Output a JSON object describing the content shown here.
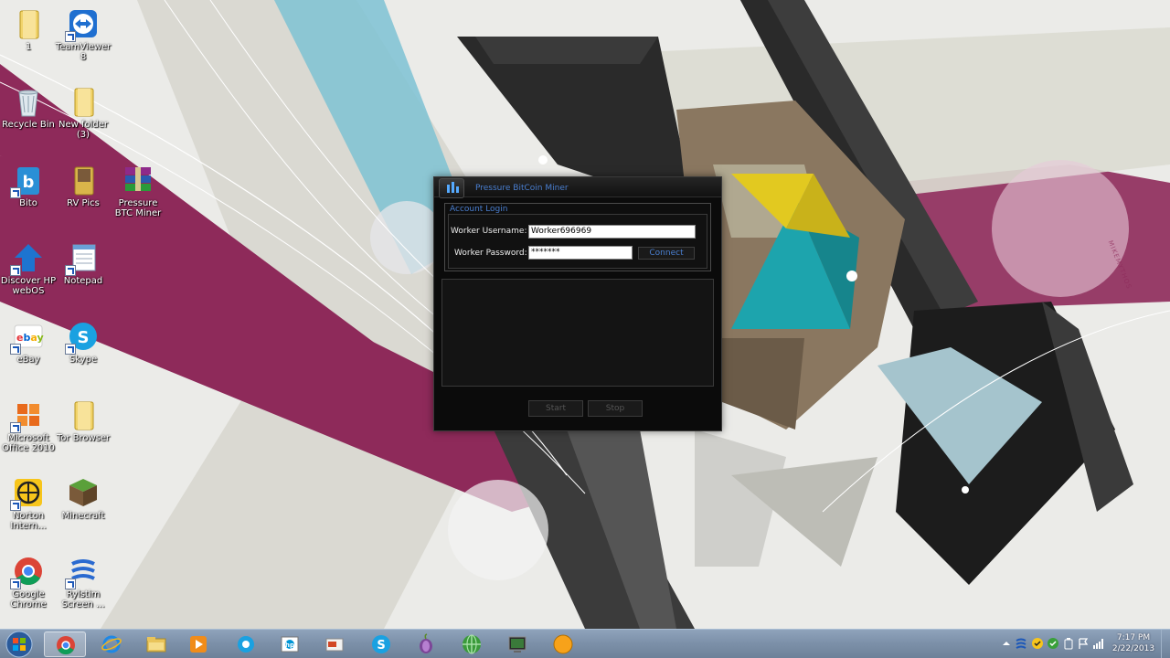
{
  "desktop": {
    "icons": [
      {
        "label": "1",
        "icon": "folder-icon"
      },
      {
        "label": "TeamViewer 8",
        "icon": "teamviewer-icon"
      },
      {
        "label": "Recycle Bin",
        "icon": "recycle-bin-icon"
      },
      {
        "label": "New folder (3)",
        "icon": "folder-icon"
      },
      {
        "label": "Bito",
        "icon": "bito-icon"
      },
      {
        "label": "RV Pics",
        "icon": "folder-icon"
      },
      {
        "label": "Pressure BTC Miner",
        "icon": "winrar-icon"
      },
      {
        "label": "Discover HP webOS",
        "icon": "hp-webos-icon"
      },
      {
        "label": "Notepad",
        "icon": "notepad-icon"
      },
      {
        "label": "eBay",
        "icon": "ebay-icon"
      },
      {
        "label": "Skype",
        "icon": "skype-icon"
      },
      {
        "label": "Microsoft Office 2010",
        "icon": "office-icon"
      },
      {
        "label": "Tor Browser",
        "icon": "folder-icon"
      },
      {
        "label": "Norton Intern...",
        "icon": "norton-icon"
      },
      {
        "label": "Minecraft",
        "icon": "minecraft-icon"
      },
      {
        "label": "Google Chrome",
        "icon": "chrome-icon"
      },
      {
        "label": "Rylstim Screen ...",
        "icon": "rylstim-icon"
      }
    ]
  },
  "wallpaper": {
    "watermark": "MIKEMYTHOS"
  },
  "miner": {
    "title": "Pressure BitCoin Miner",
    "account_legend": "Account Login",
    "username_label": "Worker Username:",
    "username_value": "Worker696969",
    "password_label": "Worker Password:",
    "password_value": "*******",
    "connect_label": "Connect",
    "start_label": "Start",
    "stop_label": "Stop"
  },
  "taskbar": {
    "pinned": [
      "chrome-icon",
      "ie-icon",
      "explorer-icon",
      "media-player-icon",
      "hp-webos-icon",
      "hp-icon",
      "ppt-icon",
      "skype-icon",
      "tor-onion-icon",
      "globe-icon",
      "miner-taskbar-icon",
      "bitcoin-icon"
    ],
    "active_index": 0,
    "clock_time": "7:17 PM",
    "clock_date": "2/22/2013"
  },
  "colors": {
    "wallpaper_magenta": "#8e2a5a",
    "wallpaper_teal": "#1da4ad",
    "wallpaper_yellow": "#e2c920",
    "miner_accent": "#4a7fd0"
  }
}
